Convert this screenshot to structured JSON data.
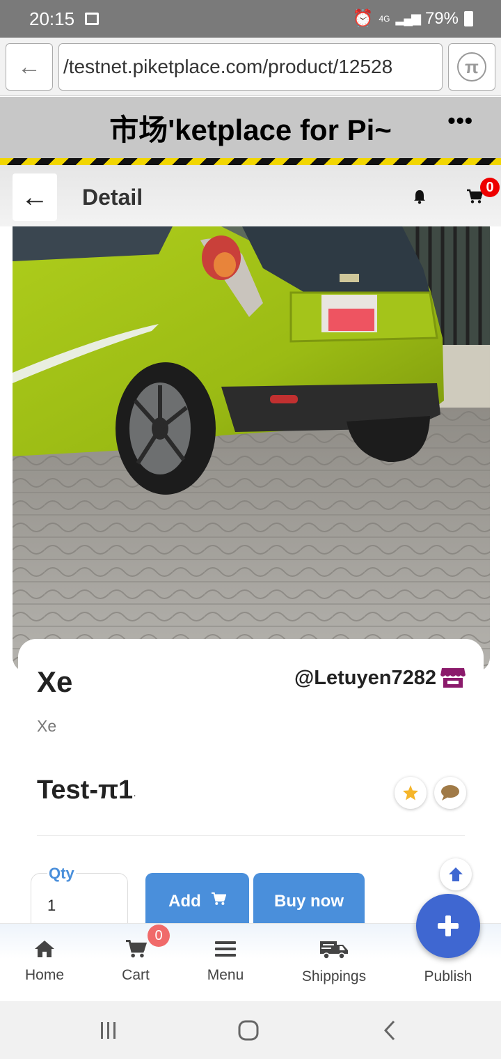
{
  "status_bar": {
    "time": "20:15",
    "network": "4G",
    "battery": "79%"
  },
  "browser": {
    "url": "/testnet.piketplace.com/product/12528"
  },
  "site": {
    "title": "市场'ketplace for Pi~"
  },
  "detail": {
    "title": "Detail",
    "cart_count": "0"
  },
  "product": {
    "name": "Xe",
    "seller": "@Letuyen7282",
    "category": "Xe",
    "price": "Test-π1",
    "price_suffix": "·"
  },
  "purchase": {
    "qty_label": "Qty",
    "qty_value": "1",
    "add_label": "Add",
    "buy_label": "Buy now"
  },
  "bottom_nav": {
    "items": [
      {
        "label": "Home",
        "icon": "home-icon"
      },
      {
        "label": "Cart",
        "icon": "cart-icon",
        "badge": "0"
      },
      {
        "label": "Menu",
        "icon": "menu-icon"
      },
      {
        "label": "Shippings",
        "icon": "truck-icon"
      },
      {
        "label": "Publish",
        "icon": "plus-icon"
      }
    ]
  },
  "colors": {
    "accent": "#4a8fdb",
    "fab": "#3f67d1",
    "badge": "#ee0000",
    "store_icon": "#8b1a6b"
  }
}
